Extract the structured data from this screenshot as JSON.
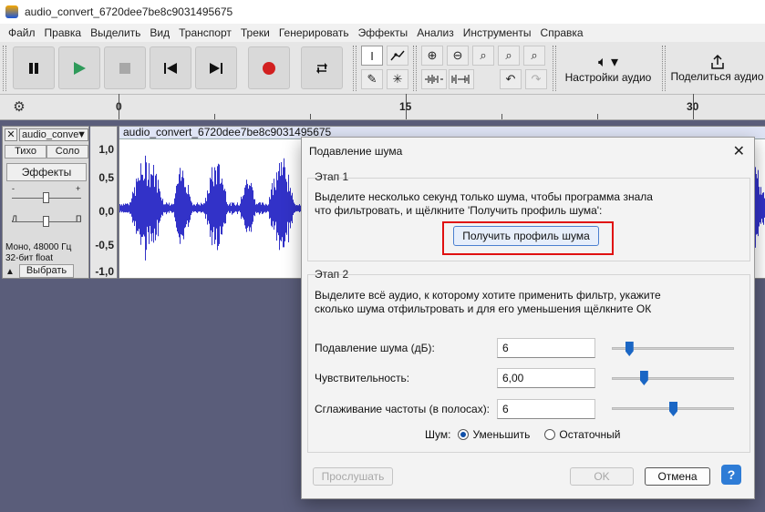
{
  "window": {
    "title": "audio_convert_6720dee7be8c9031495675"
  },
  "menu": [
    "Файл",
    "Правка",
    "Выделить",
    "Вид",
    "Транспорт",
    "Треки",
    "Генерировать",
    "Эффекты",
    "Анализ",
    "Инструменты",
    "Справка"
  ],
  "toolbar": {
    "audio_settings_label": "Настройки аудио",
    "share_audio_label": "Поделиться аудио"
  },
  "ruler": {
    "labels": [
      "0",
      "15",
      "30"
    ]
  },
  "track": {
    "name": "audio_conve",
    "mute_label": "Тихо",
    "solo_label": "Соло",
    "effects_label": "Эффекты",
    "pan_left": "Л",
    "pan_right": "П",
    "gain_minus": "-",
    "gain_plus": "+",
    "info_line1": "Моно, 48000 Гц",
    "info_line2": "32-бит float",
    "select_label": "Выбрать",
    "clip_name": "audio_convert_6720dee7be8c9031495675",
    "scale": [
      "1,0",
      "0,5",
      "0,0",
      "-0,5",
      "-1,0"
    ]
  },
  "dialog": {
    "title": "Подавление шума",
    "step1_label": "Этап 1",
    "step1_text_line1": "Выделите несколько секунд только шума, чтобы программа знала",
    "step1_text_line2": "что фильтровать, и щёлкните 'Получить профиль шума':",
    "get_profile_label": "Получить профиль шума",
    "step2_label": "Этап 2",
    "step2_text_line1": "Выделите всё аудио, к которому хотите применить фильтр, укажите",
    "step2_text_line2": "сколько шума отфильтровать и для его уменьшения щёлкните ОК",
    "params": [
      {
        "label": "Подавление шума (дБ):",
        "value": "6",
        "slider_fraction": 0.14
      },
      {
        "label": "Чувствительность:",
        "value": "6,00",
        "slider_fraction": 0.26
      },
      {
        "label": "Сглаживание частоты (в полосах):",
        "value": "6",
        "slider_fraction": 0.5
      }
    ],
    "noise_label": "Шум:",
    "reduce_label": "Уменьшить",
    "residue_label": "Остаточный",
    "preview_label": "Прослушать",
    "ok_label": "OK",
    "cancel_label": "Отмена",
    "help_label": "?"
  },
  "colors": {
    "waveform": "#3232c8",
    "highlight": "#e01010",
    "accent": "#1a66c4"
  }
}
